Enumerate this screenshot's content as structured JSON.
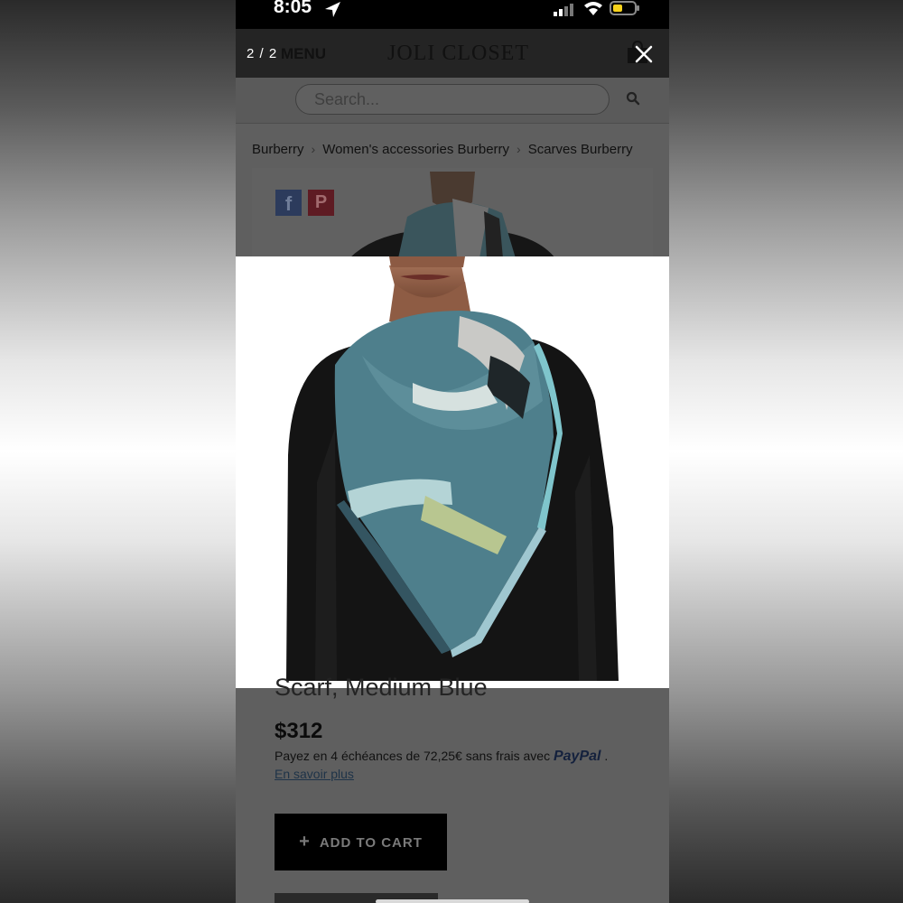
{
  "status_bar": {
    "time": "8:05"
  },
  "lightbox": {
    "counter": "2 / 2"
  },
  "header": {
    "menu_label": "MENU",
    "logo_text": "JOLI CLOSET"
  },
  "search": {
    "placeholder": "Search..."
  },
  "breadcrumb": [
    {
      "label": "Burberry"
    },
    {
      "label": "Women's accessories Burberry"
    },
    {
      "label": "Scarves Burberry"
    }
  ],
  "share": {
    "facebook": "f",
    "pinterest": "P"
  },
  "product": {
    "title": "Scarf, Medium Blue",
    "price": "$312",
    "installments_text": "Payez en 4 échéances de 72,25€ sans frais avec",
    "paypal_brand": "PayPal",
    "learn_more": "En savoir plus",
    "add_to_cart": "ADD TO CART"
  },
  "colors": {
    "scarf_teal": "#4e7f8c",
    "scarf_light": "#a9cdd3",
    "add_to_cart_bg": "#000000"
  },
  "icons": [
    "location-arrow-icon",
    "signal-icon",
    "wifi-icon",
    "battery-icon",
    "bag-icon",
    "close-icon",
    "search-icon",
    "facebook-icon",
    "pinterest-icon",
    "plus-icon"
  ]
}
